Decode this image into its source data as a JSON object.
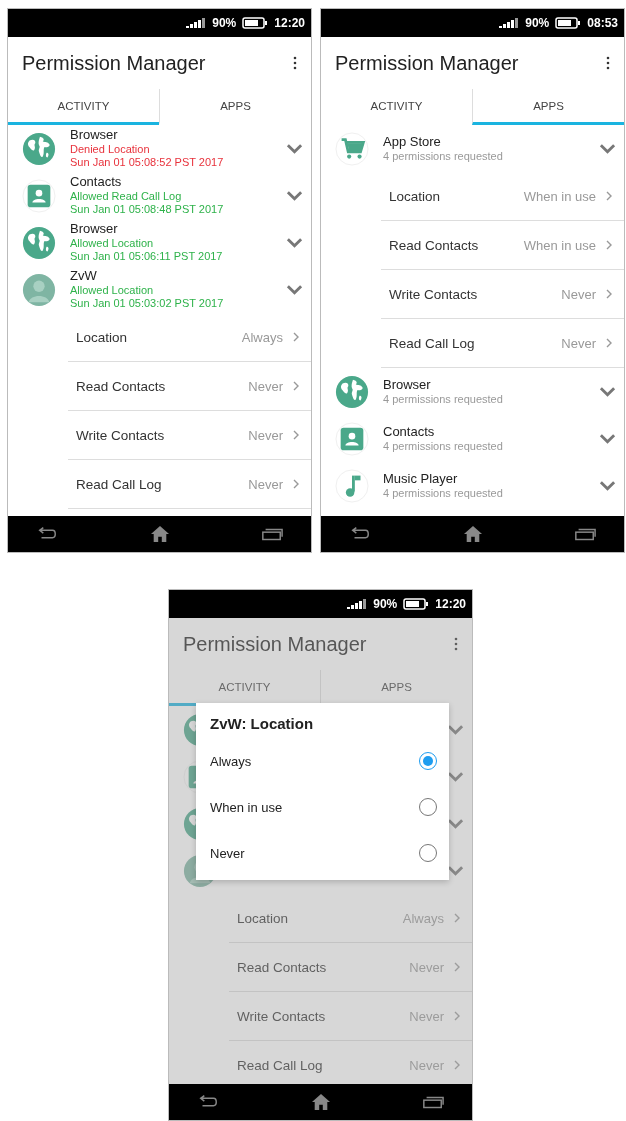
{
  "screens": [
    {
      "status_bar": {
        "battery": "90%",
        "time": "12:20"
      },
      "title": "Permission Manager",
      "dimmed": false,
      "tabs": [
        {
          "label": "ACTIVITY",
          "selected": true
        },
        {
          "label": "APPS",
          "selected": false
        }
      ],
      "items": [
        {
          "kind": "globe",
          "name": "Browser",
          "status": "Denied Location",
          "time": "Sun Jan 01 05:08:52 PST 2017",
          "color": "#e8323c"
        },
        {
          "kind": "contact",
          "name": "Contacts",
          "status": "Allowed Read Call Log",
          "time": "Sun Jan 01 05:08:48 PST 2017",
          "color": "#2eb24a"
        },
        {
          "kind": "globe",
          "name": "Browser",
          "status": "Allowed Location",
          "time": "Sun Jan 01 05:06:11 PST 2017",
          "color": "#2eb24a"
        },
        {
          "kind": "avatar",
          "name": "ZvW",
          "status": "Allowed Location",
          "time": "Sun Jan 01 05:03:02 PST 2017",
          "color": "#2eb24a",
          "permissions": [
            {
              "name": "Location",
              "value": "Always"
            },
            {
              "name": "Read Contacts",
              "value": "Never"
            },
            {
              "name": "Write Contacts",
              "value": "Never"
            },
            {
              "name": "Read Call Log",
              "value": "Never"
            }
          ]
        }
      ]
    },
    {
      "status_bar": {
        "battery": "90%",
        "time": "08:53"
      },
      "title": "Permission Manager",
      "dimmed": false,
      "tabs": [
        {
          "label": "ACTIVITY",
          "selected": false
        },
        {
          "label": "APPS",
          "selected": true
        }
      ],
      "items": [
        {
          "kind": "cart",
          "name": "App Store",
          "subtitle": "4 permissions requested",
          "permissions": [
            {
              "name": "Location",
              "value": "When in use"
            },
            {
              "name": "Read Contacts",
              "value": "When in use"
            },
            {
              "name": "Write Contacts",
              "value": "Never"
            },
            {
              "name": "Read Call Log",
              "value": "Never"
            }
          ]
        },
        {
          "kind": "globe",
          "name": "Browser",
          "subtitle": "4 permissions requested"
        },
        {
          "kind": "contact",
          "name": "Contacts",
          "subtitle": "4 permissions requested"
        },
        {
          "kind": "music",
          "name": "Music Player",
          "subtitle": "4 permissions requested"
        }
      ]
    },
    {
      "status_bar": {
        "battery": "90%",
        "time": "12:20"
      },
      "title": "Permission Manager",
      "dimmed": true,
      "tabs": [
        {
          "label": "ACTIVITY",
          "selected": true
        },
        {
          "label": "APPS",
          "selected": false
        }
      ],
      "items": [
        {
          "kind": "globe"
        },
        {
          "kind": "contact"
        },
        {
          "kind": "globe"
        },
        {
          "kind": "avatar",
          "permissions": [
            {
              "name": "Location",
              "value": "Always"
            },
            {
              "name": "Read Contacts",
              "value": "Never"
            },
            {
              "name": "Write Contacts",
              "value": "Never"
            },
            {
              "name": "Read Call Log",
              "value": "Never"
            }
          ]
        }
      ],
      "dialog": {
        "title": "ZvW: Location",
        "options": [
          {
            "label": "Always",
            "selected": true
          },
          {
            "label": "When in use",
            "selected": false
          },
          {
            "label": "Never",
            "selected": false
          }
        ]
      }
    }
  ]
}
